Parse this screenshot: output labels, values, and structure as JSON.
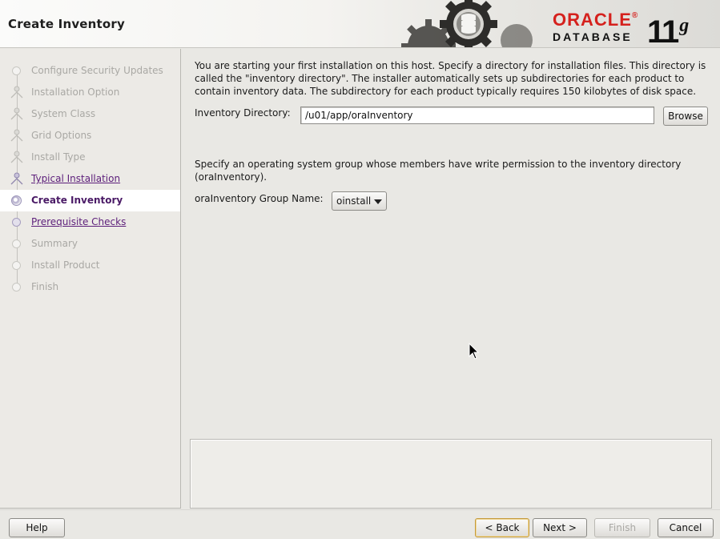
{
  "header": {
    "title": "Create Inventory",
    "brand": {
      "oracle": "ORACLE",
      "trademark": "®",
      "database": "DATABASE",
      "version": "11",
      "version_suffix": "g",
      "brand_color": "#d5211d"
    }
  },
  "steps": {
    "items": [
      {
        "label": "Configure Security Updates",
        "state": "disabled",
        "icon": "step-dot-icon"
      },
      {
        "label": "Installation Option",
        "state": "disabled",
        "icon": "step-figure-icon"
      },
      {
        "label": "System Class",
        "state": "disabled",
        "icon": "step-figure-icon"
      },
      {
        "label": "Grid Options",
        "state": "disabled",
        "icon": "step-figure-icon"
      },
      {
        "label": "Install Type",
        "state": "disabled",
        "icon": "step-figure-icon"
      },
      {
        "label": "Typical Installation",
        "state": "link",
        "icon": "step-figure-icon"
      },
      {
        "label": "Create Inventory",
        "state": "current",
        "icon": "step-current-icon"
      },
      {
        "label": "Prerequisite Checks",
        "state": "link",
        "icon": "step-dot-icon"
      },
      {
        "label": "Summary",
        "state": "disabled",
        "icon": "step-dot-icon"
      },
      {
        "label": "Install Product",
        "state": "disabled",
        "icon": "step-dot-icon"
      },
      {
        "label": "Finish",
        "state": "disabled",
        "icon": "step-dot-icon"
      }
    ]
  },
  "main": {
    "intro": "You are starting your first installation on this host. Specify a directory for installation files. This directory is called the \"inventory directory\". The installer automatically sets up subdirectories for each product to contain inventory data. The subdirectory for each product typically requires 150 kilobytes of disk space.",
    "inventory_label": "Inventory Directory:",
    "inventory_value": "/u01/app/oraInventory",
    "browse_label": "Browse",
    "group_text": "Specify an operating system group whose members have write permission to the inventory directory (oraInventory).",
    "group_label": "oraInventory Group Name:",
    "group_value": "oinstall"
  },
  "footer": {
    "help": "Help",
    "back": "< Back",
    "next": "Next >",
    "finish": "Finish",
    "cancel": "Cancel"
  }
}
